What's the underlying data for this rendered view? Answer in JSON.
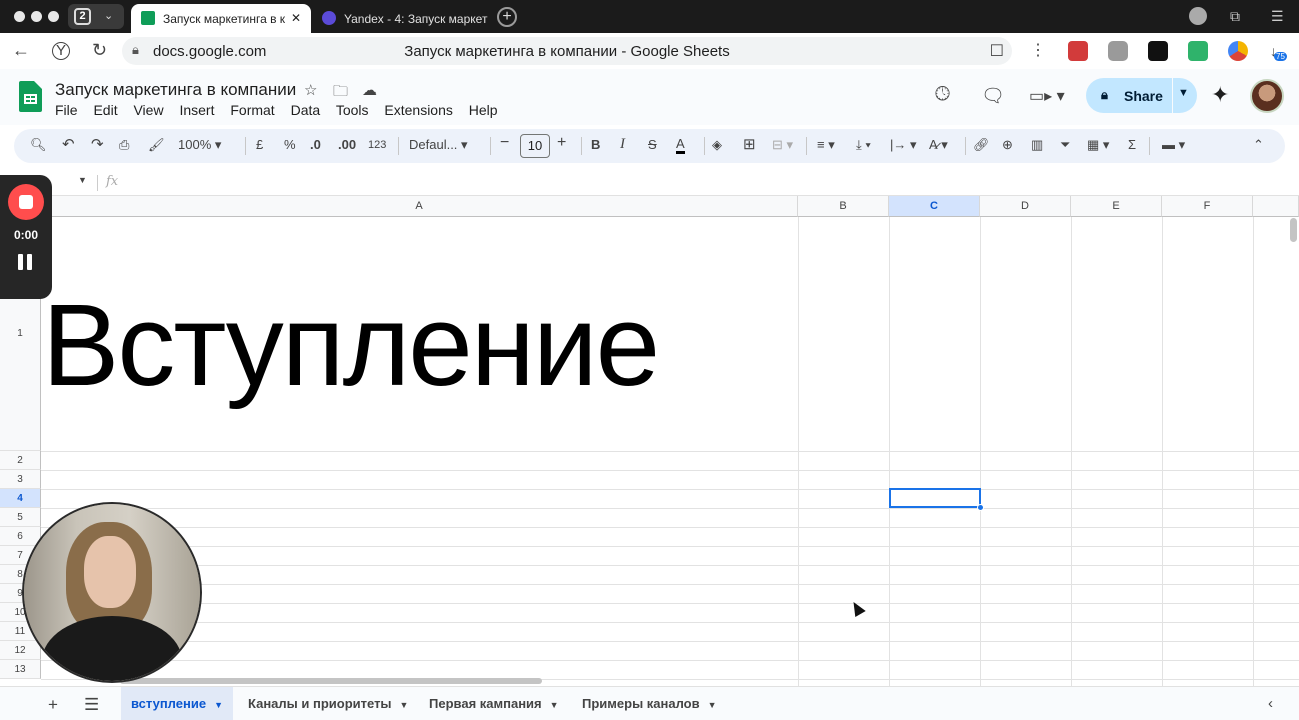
{
  "browser": {
    "tab_count": "2",
    "tabs": [
      {
        "title": "Запуск маркетинга в к",
        "favicon": "sheets-icon",
        "color": "#0f9d58"
      },
      {
        "title": "Yandex - 4: Запуск маркет",
        "favicon": "yandex-star-icon",
        "color": "#5b4bd8"
      }
    ],
    "url": "docs.google.com",
    "page_title": "Запуск маркетинга в компании - Google Sheets",
    "downloads_badge": "75"
  },
  "doc": {
    "title": "Запуск маркетинга в компании",
    "menus": [
      "File",
      "Edit",
      "View",
      "Insert",
      "Format",
      "Data",
      "Tools",
      "Extensions",
      "Help"
    ],
    "share_label": "Share"
  },
  "toolbar": {
    "zoom": "100%",
    "currency": "£",
    "percent": "%",
    "decrease_decimal": ".0",
    "increase_decimal": ".00",
    "number_format": "123",
    "font": "Defaul...",
    "font_size": "10"
  },
  "formula": {
    "fx": "fx"
  },
  "grid": {
    "columns": [
      "A",
      "B",
      "C",
      "D",
      "E",
      "F"
    ],
    "selected_column": "C",
    "rows": [
      "1",
      "2",
      "3",
      "4",
      "5",
      "6",
      "7",
      "8",
      "9",
      "10",
      "11",
      "12",
      "13"
    ],
    "selected_row": "4",
    "cell_a1": "Вступление"
  },
  "sheets": {
    "tabs": [
      "вступление",
      "Каналы и приоритеты",
      "Первая кампания",
      "Примеры каналов"
    ],
    "active": "вступление"
  },
  "recorder": {
    "time": "0:00"
  },
  "colors": {
    "accent": "#1a73e8",
    "share_bg": "#c2e7ff",
    "sheets_green": "#0f9d58",
    "record_red": "#ff4d4d"
  }
}
